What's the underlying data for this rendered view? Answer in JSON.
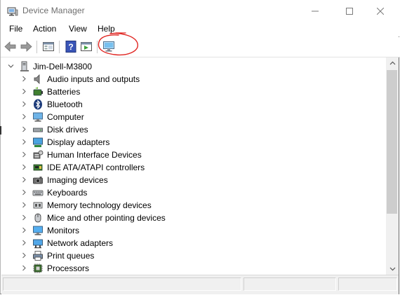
{
  "window": {
    "title": "Device Manager"
  },
  "menu": [
    "File",
    "Action",
    "View",
    "Help"
  ],
  "tree": {
    "root_label": "Jim-Dell-M3800",
    "items": [
      {
        "label": "Audio inputs and outputs",
        "icon": "speaker-icon"
      },
      {
        "label": "Batteries",
        "icon": "battery-icon"
      },
      {
        "label": "Bluetooth",
        "icon": "bluetooth-icon"
      },
      {
        "label": "Computer",
        "icon": "computer-icon"
      },
      {
        "label": "Disk drives",
        "icon": "disk-drive-icon"
      },
      {
        "label": "Display adapters",
        "icon": "display-adapter-icon"
      },
      {
        "label": "Human Interface Devices",
        "icon": "hid-icon"
      },
      {
        "label": "IDE ATA/ATAPI controllers",
        "icon": "ide-controller-icon"
      },
      {
        "label": "Imaging devices",
        "icon": "camera-icon"
      },
      {
        "label": "Keyboards",
        "icon": "keyboard-icon"
      },
      {
        "label": "Memory technology devices",
        "icon": "memory-icon"
      },
      {
        "label": "Mice and other pointing devices",
        "icon": "mouse-icon"
      },
      {
        "label": "Monitors",
        "icon": "monitor-icon"
      },
      {
        "label": "Network adapters",
        "icon": "network-adapter-icon"
      },
      {
        "label": "Print queues",
        "icon": "printer-icon"
      },
      {
        "label": "Processors",
        "icon": "processor-icon"
      }
    ]
  },
  "colors": {
    "annotation": "#e0231f",
    "accent": "#2d7bd1"
  }
}
